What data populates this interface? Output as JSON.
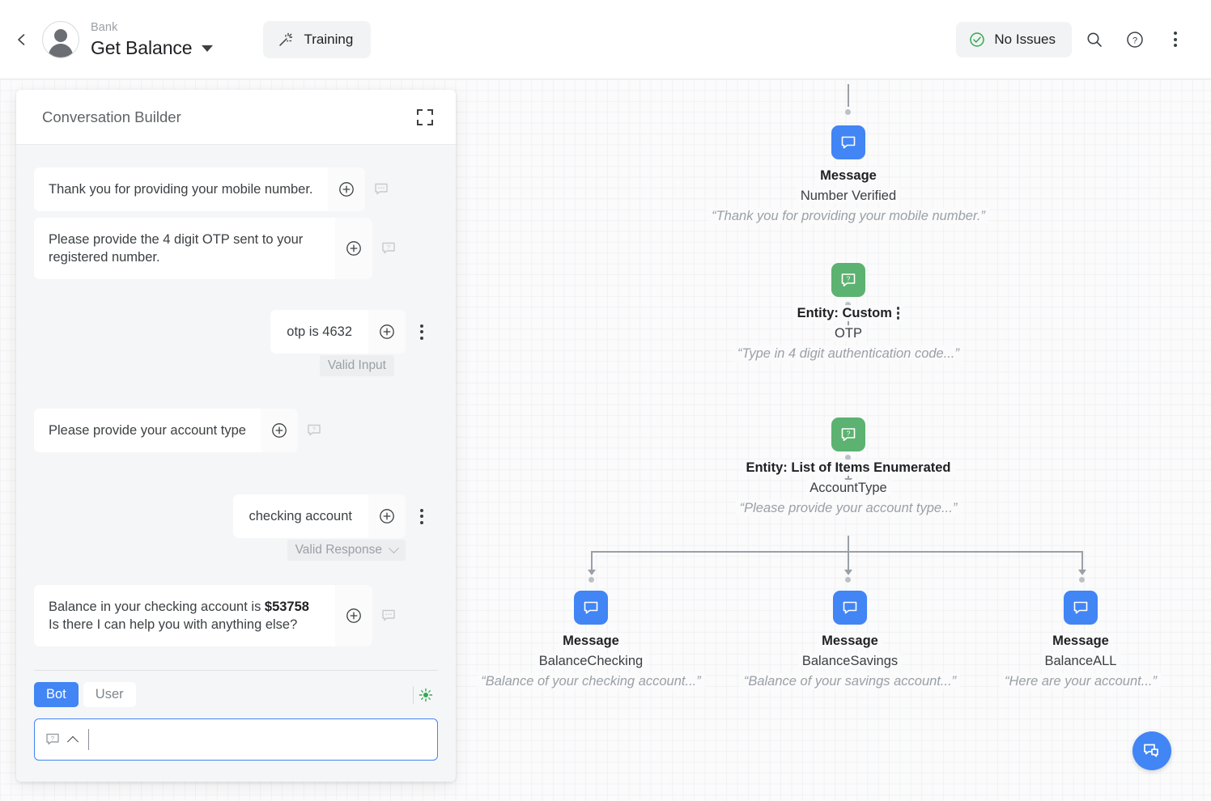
{
  "header": {
    "back_icon": "chevron-left-icon",
    "avatar_icon": "user-avatar-icon",
    "breadcrumb": "Bank",
    "title": "Get Balance",
    "title_caret_icon": "caret-down-icon",
    "training_label": "Training",
    "training_icon": "magic-wand-icon",
    "issues_label": "No Issues",
    "issues_icon": "check-circle-icon",
    "issues_color": "#34a853",
    "search_icon": "search-icon",
    "help_icon": "help-circle-icon",
    "more_icon": "kebab-menu-icon"
  },
  "builder": {
    "title": "Conversation Builder",
    "collapse_icon": "collapse-icon",
    "messages": [
      {
        "side": "bot",
        "text": "Thank you for providing your mobile number.",
        "add_icon": "plus-circle-icon",
        "side_icon": "comment-icon"
      },
      {
        "side": "bot",
        "text": "Please provide the 4 digit OTP sent to your registered number.",
        "add_icon": "plus-circle-icon",
        "side_icon": "question-comment-icon"
      },
      {
        "side": "user",
        "text": "otp is 4632",
        "add_icon": "plus-circle-icon",
        "side_icon": "kebab-menu-icon",
        "status": "Valid Input",
        "status_has_chevron": false
      },
      {
        "side": "bot",
        "text": "Please provide your account type",
        "add_icon": "plus-circle-icon",
        "side_icon": "question-comment-icon"
      },
      {
        "side": "user",
        "text": "checking account",
        "add_icon": "plus-circle-icon",
        "side_icon": "kebab-menu-icon",
        "status": "Valid Response",
        "status_has_chevron": true
      },
      {
        "side": "bot",
        "text_pre": "Balance in your checking account is ",
        "text_bold": "$53758",
        "text_post": "Is there I can help you with anything else?",
        "add_icon": "plus-circle-icon",
        "side_icon": "comment-icon"
      }
    ],
    "composer": {
      "bot_label": "Bot",
      "user_label": "User",
      "bot_active_color": "#4285f4",
      "live_icon": "live-indicator-icon",
      "live_color": "#34a853",
      "input_value": "",
      "input_placeholder": "",
      "prefix_icon": "question-comment-icon",
      "expand_icon": "chevron-up-icon"
    }
  },
  "flow": {
    "nodes": [
      {
        "id": "number-verified",
        "type": "Message",
        "name": "Number Verified",
        "quote": "“Thank you for providing your mobile number.”",
        "icon": "message-icon",
        "color": "#4285f4",
        "has_kebab": false
      },
      {
        "id": "otp",
        "type": "Entity: Custom",
        "name": "OTP",
        "quote": "“Type in 4 digit authentication code...”",
        "icon": "question-message-icon",
        "color": "#5cb270",
        "has_kebab": true
      },
      {
        "id": "account-type",
        "type": "Entity: List of Items Enumerated",
        "name": "AccountType",
        "quote": "“Please provide your account type...”",
        "icon": "question-message-icon",
        "color": "#5cb270",
        "has_kebab": false
      },
      {
        "id": "balance-checking",
        "type": "Message",
        "name": "BalanceChecking",
        "quote": "“Balance of your checking account...”",
        "icon": "message-icon",
        "color": "#4285f4",
        "has_kebab": false
      },
      {
        "id": "balance-savings",
        "type": "Message",
        "name": "BalanceSavings",
        "quote": "“Balance of your savings account...”",
        "icon": "message-icon",
        "color": "#4285f4",
        "has_kebab": false
      },
      {
        "id": "balance-all",
        "type": "Message",
        "name": "BalanceALL",
        "quote": "“Here are your account...”",
        "icon": "message-icon",
        "color": "#4285f4",
        "has_kebab": false
      }
    ],
    "fab_icon": "chat-bubbles-icon"
  }
}
